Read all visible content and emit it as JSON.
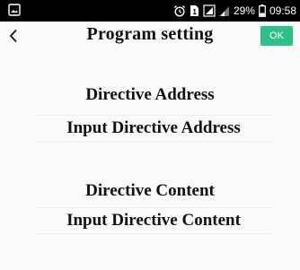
{
  "status_bar": {
    "icons": [
      "image-icon",
      "alarm-icon",
      "sim-icon",
      "signal-icon",
      "signal-alt-icon",
      "battery-icon"
    ],
    "battery_percent": "29%",
    "time": "09:58"
  },
  "header": {
    "title": "Program setting",
    "ok_label": "OK",
    "accent_color": "#2fc08a"
  },
  "form": {
    "address_label": "Directive Address",
    "address_placeholder": "Input Directive Address",
    "content_label": "Directive Content",
    "content_placeholder": "Input Directive Content"
  }
}
